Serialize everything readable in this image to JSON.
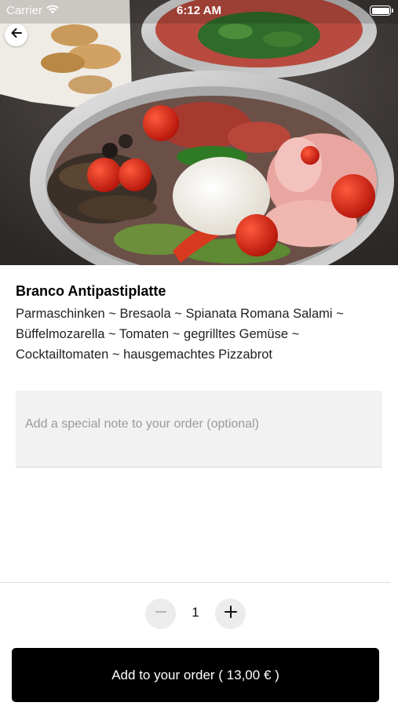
{
  "status_bar": {
    "carrier": "Carrier",
    "time": "6:12 AM"
  },
  "hero": {
    "image_name": "antipasti-platter-photo"
  },
  "product": {
    "title": "Branco Antipastiplatte",
    "description": "Parmaschinken ~ Bresaola ~ Spianata Romana Salami ~ Büffelmozarella ~ Tomaten ~ gegrilltes Gemüse ~ Cocktailtomaten ~ hausgemachtes Pizzabrot"
  },
  "note": {
    "placeholder": "Add a special note to your order (optional)",
    "value": ""
  },
  "quantity": {
    "value": "1"
  },
  "cart": {
    "add_label": "Add to your order ( 13,00 € )"
  },
  "icons": {
    "back": "arrow-left-icon",
    "minus": "minus-icon",
    "plus": "plus-icon",
    "wifi": "wifi-icon",
    "battery": "battery-icon"
  },
  "colors": {
    "primary_button": "#000000",
    "stepper_bg": "#ececec",
    "note_bg": "#f2f2f2"
  }
}
